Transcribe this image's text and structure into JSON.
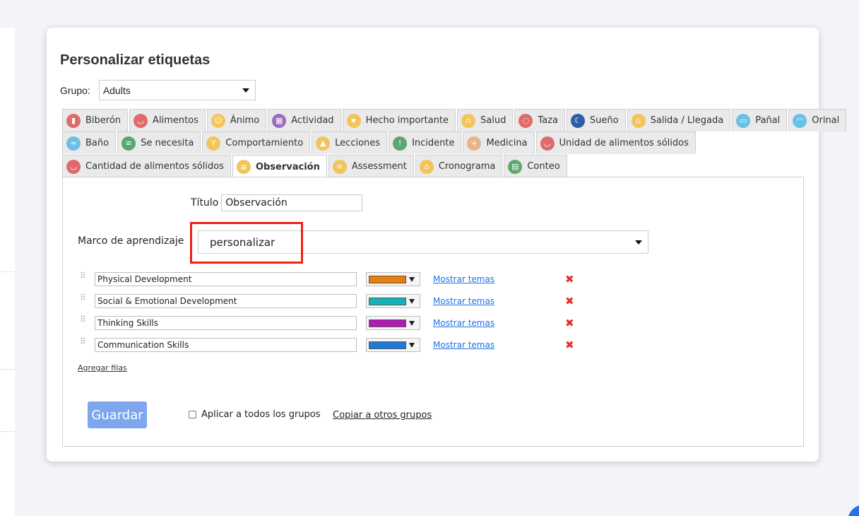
{
  "page": {
    "title": "Personalizar etiquetas"
  },
  "group": {
    "label": "Grupo:",
    "selected": "Adults"
  },
  "tabs": {
    "row1": [
      {
        "label": "Biberón",
        "icon": "bottle-icon",
        "color": "#e06a6a"
      },
      {
        "label": "Alimentos",
        "icon": "bowl-icon",
        "color": "#e06a6a"
      },
      {
        "label": "Ánimo",
        "icon": "mood-icon",
        "color": "#f2c45a"
      },
      {
        "label": "Actividad",
        "icon": "blocks-icon",
        "color": "#9a6ac0"
      },
      {
        "label": "Hecho importante",
        "icon": "star-icon",
        "color": "#f2c45a"
      },
      {
        "label": "Salud",
        "icon": "stethoscope-icon",
        "color": "#f2c45a"
      },
      {
        "label": "Taza",
        "icon": "cup-icon",
        "color": "#e06a6a"
      },
      {
        "label": "Sueño",
        "icon": "moon-icon",
        "color": "#2f5ea8"
      },
      {
        "label": "Salida / Llegada",
        "icon": "house-icon",
        "color": "#f2c45a"
      },
      {
        "label": "Pañal",
        "icon": "diaper-icon",
        "color": "#6ac0e6"
      },
      {
        "label": "Orinal",
        "icon": "potty-icon",
        "color": "#6ac0e6"
      }
    ],
    "row2": [
      {
        "label": "Baño",
        "icon": "bath-icon",
        "color": "#6ac0e6"
      },
      {
        "label": "Se necesita",
        "icon": "list-icon",
        "color": "#5aa86a"
      },
      {
        "label": "Comportamiento",
        "icon": "trophy-icon",
        "color": "#f2c45a"
      },
      {
        "label": "Lecciones",
        "icon": "graduation-cap-icon",
        "color": "#f2c45a"
      },
      {
        "label": "Incidente",
        "icon": "warning-icon",
        "color": "#5aa86a"
      },
      {
        "label": "Medicina",
        "icon": "medicine-icon",
        "color": "#e6b48a"
      },
      {
        "label": "Unidad de alimentos sólidos",
        "icon": "bowl-icon",
        "color": "#e06a6a"
      }
    ],
    "row3": [
      {
        "label": "Cantidad de alimentos sólidos",
        "icon": "bowl-icon",
        "color": "#e06a6a",
        "active": false
      },
      {
        "label": "Observación",
        "icon": "note-icon",
        "color": "#f2c45a",
        "active": true
      },
      {
        "label": "Assessment",
        "icon": "note-icon",
        "color": "#f2c45a",
        "active": false
      },
      {
        "label": "Cronograma",
        "icon": "house-icon",
        "color": "#f2c45a",
        "active": false
      },
      {
        "label": "Conteo",
        "icon": "counter-icon",
        "color": "#5aa86a",
        "active": false
      }
    ]
  },
  "form": {
    "title_label": "Título",
    "title_value": "Observación",
    "framework_label": "Marco de aprendizaje",
    "framework_value": "personalizar",
    "domains": [
      {
        "name": "Physical Development",
        "color": "#e8800f"
      },
      {
        "name": "Social & Emotional Development",
        "color": "#14b3b8"
      },
      {
        "name": "Thinking Skills",
        "color": "#b21ab8"
      },
      {
        "name": "Communication Skills",
        "color": "#1f7ad4"
      }
    ],
    "show_topics_label": "Mostrar temas",
    "add_rows_label": "Agregar filas",
    "save_label": "Guardar",
    "apply_all_label": "Aplicar a todos los grupos",
    "copy_label": "Copiar a otros grupos"
  }
}
